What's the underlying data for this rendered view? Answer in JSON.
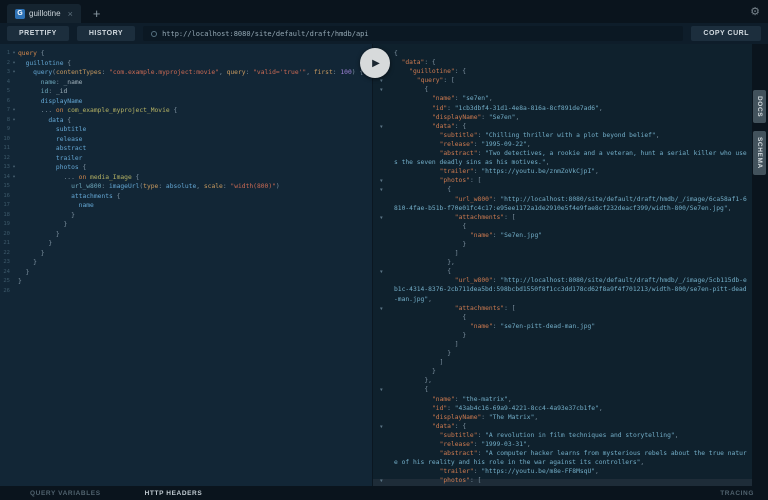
{
  "tabbar": {
    "badge": "G",
    "title": "guillotine",
    "close": "×",
    "new_tab": "+"
  },
  "toolbar": {
    "prettify": "PRETTIFY",
    "history": "HISTORY",
    "url": "http://localhost:8080/site/default/draft/hmdb/api",
    "copy_curl": "COPY CURL"
  },
  "side_tabs": {
    "docs": "DOCS",
    "schema": "SCHEMA"
  },
  "footer": {
    "query_variables": "QUERY VARIABLES",
    "http_headers": "HTTP HEADERS",
    "tracing": "TRACING"
  },
  "icons": {
    "gear": "⚙",
    "play": "▶",
    "fold_editor": "▾",
    "fold_response": "▼"
  },
  "colors": {
    "tab_badge": "#2e72b5",
    "editor_bg": "#122636",
    "response_bg": "#0f212d",
    "keyword": "#d2874c",
    "field": "#64a7d4",
    "string": "#cb6a54",
    "number": "#a184d9",
    "type": "#b5b264",
    "json_key": "#cd7a50",
    "json_value": "#73aec8"
  },
  "editor": {
    "lines": [
      {
        "f": true,
        "t": [
          [
            "k",
            "query"
          ],
          [
            "p",
            " {"
          ]
        ]
      },
      {
        "f": true,
        "t": [
          [
            "p",
            "  "
          ],
          [
            "f",
            "guillotine"
          ],
          [
            "p",
            " {"
          ]
        ]
      },
      {
        "f": true,
        "t": [
          [
            "p",
            "    "
          ],
          [
            "f",
            "query"
          ],
          [
            "p",
            "("
          ],
          [
            "a",
            "contentTypes"
          ],
          [
            "p",
            ": "
          ],
          [
            "s",
            "\"com.example.myproject:movie\""
          ],
          [
            "p",
            ", "
          ],
          [
            "a",
            "query"
          ],
          [
            "p",
            ": "
          ],
          [
            "s",
            "\"valid='true'\""
          ],
          [
            "p",
            ", "
          ],
          [
            "a",
            "first"
          ],
          [
            "p",
            ": "
          ],
          [
            "n",
            "100"
          ],
          [
            "p",
            ") {"
          ]
        ]
      },
      {
        "t": [
          [
            "p",
            "      "
          ],
          [
            "l",
            "name"
          ],
          [
            "p",
            ": "
          ],
          [
            "v",
            "_name"
          ]
        ]
      },
      {
        "t": [
          [
            "p",
            "      "
          ],
          [
            "l",
            "id"
          ],
          [
            "p",
            ": "
          ],
          [
            "v",
            "_id"
          ]
        ]
      },
      {
        "t": [
          [
            "p",
            "      "
          ],
          [
            "f",
            "displayName"
          ]
        ]
      },
      {
        "f": true,
        "t": [
          [
            "p",
            "      ... "
          ],
          [
            "k",
            "on"
          ],
          [
            "y",
            " com_example_myproject_Movie"
          ],
          [
            "p",
            " {"
          ]
        ]
      },
      {
        "f": true,
        "t": [
          [
            "p",
            "        "
          ],
          [
            "f",
            "data"
          ],
          [
            "p",
            " {"
          ]
        ]
      },
      {
        "t": [
          [
            "p",
            "          "
          ],
          [
            "f",
            "subtitle"
          ]
        ]
      },
      {
        "t": [
          [
            "p",
            "          "
          ],
          [
            "f",
            "release"
          ]
        ]
      },
      {
        "t": [
          [
            "p",
            "          "
          ],
          [
            "f",
            "abstract"
          ]
        ]
      },
      {
        "t": [
          [
            "p",
            "          "
          ],
          [
            "f",
            "trailer"
          ]
        ]
      },
      {
        "f": true,
        "t": [
          [
            "p",
            "          "
          ],
          [
            "f",
            "photos"
          ],
          [
            "p",
            " {"
          ]
        ]
      },
      {
        "f": true,
        "t": [
          [
            "p",
            "            ... "
          ],
          [
            "k",
            "on"
          ],
          [
            "y",
            " media_Image"
          ],
          [
            "p",
            " {"
          ]
        ]
      },
      {
        "t": [
          [
            "p",
            "              "
          ],
          [
            "l",
            "url_w800"
          ],
          [
            "p",
            ": "
          ],
          [
            "f",
            "imageUrl"
          ],
          [
            "p",
            "("
          ],
          [
            "a",
            "type"
          ],
          [
            "p",
            ": "
          ],
          [
            "e",
            "absolute"
          ],
          [
            "p",
            ", "
          ],
          [
            "a",
            "scale"
          ],
          [
            "p",
            ": "
          ],
          [
            "s",
            "\"width(800)\""
          ],
          [
            "p",
            ")"
          ]
        ]
      },
      {
        "t": [
          [
            "p",
            "              "
          ],
          [
            "f",
            "attachments"
          ],
          [
            "p",
            " {"
          ]
        ]
      },
      {
        "t": [
          [
            "p",
            "                "
          ],
          [
            "f",
            "name"
          ]
        ]
      },
      {
        "t": [
          [
            "p",
            "              }"
          ]
        ]
      },
      {
        "t": [
          [
            "p",
            "            }"
          ]
        ]
      },
      {
        "t": [
          [
            "p",
            "          }"
          ]
        ]
      },
      {
        "t": [
          [
            "p",
            "        }"
          ]
        ]
      },
      {
        "t": [
          [
            "p",
            "      }"
          ]
        ]
      },
      {
        "t": [
          [
            "p",
            "    }"
          ]
        ]
      },
      {
        "t": [
          [
            "p",
            "  }"
          ]
        ]
      },
      {
        "t": [
          [
            "p",
            "}"
          ]
        ]
      },
      {
        "t": [
          [
            "p",
            ""
          ]
        ]
      }
    ]
  },
  "response": {
    "lines": [
      {
        "d": 0,
        "f": true,
        "t": [
          [
            "P",
            "{"
          ]
        ]
      },
      {
        "d": 1,
        "f": true,
        "t": [
          [
            "K",
            "\"data\""
          ],
          [
            "P",
            ": {"
          ]
        ]
      },
      {
        "d": 2,
        "f": true,
        "t": [
          [
            "K",
            "\"guillotine\""
          ],
          [
            "P",
            ": {"
          ]
        ]
      },
      {
        "d": 3,
        "f": true,
        "t": [
          [
            "K",
            "\"query\""
          ],
          [
            "P",
            ": ["
          ]
        ]
      },
      {
        "d": 4,
        "f": true,
        "t": [
          [
            "P",
            "{"
          ]
        ]
      },
      {
        "d": 5,
        "t": [
          [
            "K",
            "\"name\""
          ],
          [
            "P",
            ": "
          ],
          [
            "V",
            "\"se7en\""
          ],
          [
            "P",
            ","
          ]
        ]
      },
      {
        "d": 5,
        "t": [
          [
            "K",
            "\"id\""
          ],
          [
            "P",
            ": "
          ],
          [
            "V",
            "\"1cb3dbf4-31d1-4e8a-816a-8cf891de7ad6\""
          ],
          [
            "P",
            ","
          ]
        ]
      },
      {
        "d": 5,
        "t": [
          [
            "K",
            "\"displayName\""
          ],
          [
            "P",
            ": "
          ],
          [
            "V",
            "\"Se7en\""
          ],
          [
            "P",
            ","
          ]
        ]
      },
      {
        "d": 5,
        "f": true,
        "t": [
          [
            "K",
            "\"data\""
          ],
          [
            "P",
            ": {"
          ]
        ]
      },
      {
        "d": 6,
        "t": [
          [
            "K",
            "\"subtitle\""
          ],
          [
            "P",
            ": "
          ],
          [
            "V",
            "\"Chilling thriller with a plot beyond belief\""
          ],
          [
            "P",
            ","
          ]
        ]
      },
      {
        "d": 6,
        "t": [
          [
            "K",
            "\"release\""
          ],
          [
            "P",
            ": "
          ],
          [
            "V",
            "\"1995-09-22\""
          ],
          [
            "P",
            ","
          ]
        ]
      },
      {
        "d": 6,
        "t": [
          [
            "K",
            "\"abstract\""
          ],
          [
            "P",
            ": "
          ],
          [
            "V",
            "\"Two detectives, a rookie and a veteran, hunt a serial killer who uses the seven deadly sins as his motives.\""
          ],
          [
            "P",
            ","
          ]
        ]
      },
      {
        "d": 6,
        "t": [
          [
            "K",
            "\"trailer\""
          ],
          [
            "P",
            ": "
          ],
          [
            "V",
            "\"https://youtu.be/znmZoVkCjpI\""
          ],
          [
            "P",
            ","
          ]
        ]
      },
      {
        "d": 6,
        "f": true,
        "t": [
          [
            "K",
            "\"photos\""
          ],
          [
            "P",
            ": ["
          ]
        ]
      },
      {
        "d": 7,
        "f": true,
        "t": [
          [
            "P",
            "{"
          ]
        ]
      },
      {
        "d": 8,
        "t": [
          [
            "K",
            "\"url_w800\""
          ],
          [
            "P",
            ": "
          ],
          [
            "V",
            "\"http://localhost:8080/site/default/draft/hmdb/_/image/6ca58af1-6810-4fae-b51b-f70e01fc4c17:e95ee1172a1de2910e5f4e9fae8cf232deacf399/width-800/Se7en.jpg\""
          ],
          [
            "P",
            ","
          ]
        ]
      },
      {
        "d": 8,
        "f": true,
        "t": [
          [
            "K",
            "\"attachments\""
          ],
          [
            "P",
            ": ["
          ]
        ]
      },
      {
        "d": 9,
        "t": [
          [
            "P",
            "{"
          ]
        ]
      },
      {
        "d": 10,
        "t": [
          [
            "K",
            "\"name\""
          ],
          [
            "P",
            ": "
          ],
          [
            "V",
            "\"Se7en.jpg\""
          ]
        ]
      },
      {
        "d": 9,
        "t": [
          [
            "P",
            "}"
          ]
        ]
      },
      {
        "d": 8,
        "t": [
          [
            "P",
            "]"
          ]
        ]
      },
      {
        "d": 7,
        "t": [
          [
            "P",
            "},"
          ]
        ]
      },
      {
        "d": 7,
        "f": true,
        "t": [
          [
            "P",
            "{"
          ]
        ]
      },
      {
        "d": 8,
        "t": [
          [
            "K",
            "\"url_w800\""
          ],
          [
            "P",
            ": "
          ],
          [
            "V",
            "\"http://localhost:8080/site/default/draft/hmdb/_/image/5cb115db-eb1c-4314-8376-2cb711dea5bd:598bcbd1550f8f1cc3dd178cd62f8a9f4f701213/width-800/se7en-pitt-dead-man.jpg\""
          ],
          [
            "P",
            ","
          ]
        ]
      },
      {
        "d": 8,
        "f": true,
        "t": [
          [
            "K",
            "\"attachments\""
          ],
          [
            "P",
            ": ["
          ]
        ]
      },
      {
        "d": 9,
        "t": [
          [
            "P",
            "{"
          ]
        ]
      },
      {
        "d": 10,
        "t": [
          [
            "K",
            "\"name\""
          ],
          [
            "P",
            ": "
          ],
          [
            "V",
            "\"se7en-pitt-dead-man.jpg\""
          ]
        ]
      },
      {
        "d": 9,
        "t": [
          [
            "P",
            "}"
          ]
        ]
      },
      {
        "d": 8,
        "t": [
          [
            "P",
            "]"
          ]
        ]
      },
      {
        "d": 7,
        "t": [
          [
            "P",
            "}"
          ]
        ]
      },
      {
        "d": 6,
        "t": [
          [
            "P",
            "]"
          ]
        ]
      },
      {
        "d": 5,
        "t": [
          [
            "P",
            "}"
          ]
        ]
      },
      {
        "d": 4,
        "t": [
          [
            "P",
            "},"
          ]
        ]
      },
      {
        "d": 4,
        "f": true,
        "t": [
          [
            "P",
            "{"
          ]
        ]
      },
      {
        "d": 5,
        "t": [
          [
            "K",
            "\"name\""
          ],
          [
            "P",
            ": "
          ],
          [
            "V",
            "\"the-matrix\""
          ],
          [
            "P",
            ","
          ]
        ]
      },
      {
        "d": 5,
        "t": [
          [
            "K",
            "\"id\""
          ],
          [
            "P",
            ": "
          ],
          [
            "V",
            "\"43ab4c16-69a9-4221-8cc4-4a93e37cb1fe\""
          ],
          [
            "P",
            ","
          ]
        ]
      },
      {
        "d": 5,
        "t": [
          [
            "K",
            "\"displayName\""
          ],
          [
            "P",
            ": "
          ],
          [
            "V",
            "\"The Matrix\""
          ],
          [
            "P",
            ","
          ]
        ]
      },
      {
        "d": 5,
        "f": true,
        "t": [
          [
            "K",
            "\"data\""
          ],
          [
            "P",
            ": {"
          ]
        ]
      },
      {
        "d": 6,
        "t": [
          [
            "K",
            "\"subtitle\""
          ],
          [
            "P",
            ": "
          ],
          [
            "V",
            "\"A revolution in film techniques and storytelling\""
          ],
          [
            "P",
            ","
          ]
        ]
      },
      {
        "d": 6,
        "t": [
          [
            "K",
            "\"release\""
          ],
          [
            "P",
            ": "
          ],
          [
            "V",
            "\"1999-03-31\""
          ],
          [
            "P",
            ","
          ]
        ]
      },
      {
        "d": 6,
        "t": [
          [
            "K",
            "\"abstract\""
          ],
          [
            "P",
            ": "
          ],
          [
            "V",
            "\"A computer hacker learns from mysterious rebels about the true nature of his reality and his role in the war against its controllers\""
          ],
          [
            "P",
            ","
          ]
        ]
      },
      {
        "d": 6,
        "t": [
          [
            "K",
            "\"trailer\""
          ],
          [
            "P",
            ": "
          ],
          [
            "V",
            "\"https://youtu.be/m8e-FF8MsqU\""
          ],
          [
            "P",
            ","
          ]
        ]
      },
      {
        "d": 6,
        "f": true,
        "t": [
          [
            "K",
            "\"photos\""
          ],
          [
            "P",
            ": ["
          ]
        ]
      }
    ]
  }
}
